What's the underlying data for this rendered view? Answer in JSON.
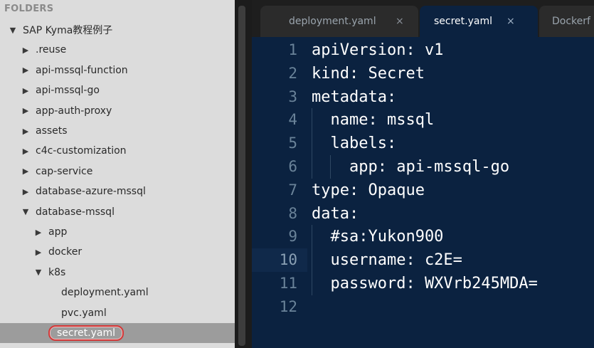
{
  "sidebar": {
    "header": "FOLDERS",
    "items": [
      {
        "label": "SAP Kyma教程例子",
        "state": "expanded",
        "depth": 0
      },
      {
        "label": ".reuse",
        "state": "collapsed",
        "depth": 1
      },
      {
        "label": "api-mssql-function",
        "state": "collapsed",
        "depth": 1
      },
      {
        "label": "api-mssql-go",
        "state": "collapsed",
        "depth": 1
      },
      {
        "label": "app-auth-proxy",
        "state": "collapsed",
        "depth": 1
      },
      {
        "label": "assets",
        "state": "collapsed",
        "depth": 1
      },
      {
        "label": "c4c-customization",
        "state": "collapsed",
        "depth": 1
      },
      {
        "label": "cap-service",
        "state": "collapsed",
        "depth": 1
      },
      {
        "label": "database-azure-mssql",
        "state": "collapsed",
        "depth": 1
      },
      {
        "label": "database-mssql",
        "state": "expanded",
        "depth": 1
      },
      {
        "label": "app",
        "state": "collapsed",
        "depth": 2
      },
      {
        "label": "docker",
        "state": "collapsed",
        "depth": 2
      },
      {
        "label": "k8s",
        "state": "expanded",
        "depth": 2
      },
      {
        "label": "deployment.yaml",
        "state": "file",
        "depth": 3
      },
      {
        "label": "pvc.yaml",
        "state": "file",
        "depth": 3
      },
      {
        "label": "secret.yaml",
        "state": "file-selected",
        "depth": 3
      }
    ]
  },
  "tabs": [
    {
      "label": "deployment.yaml",
      "close": "×",
      "active": false
    },
    {
      "label": "secret.yaml",
      "close": "×",
      "active": true
    },
    {
      "label": "Dockerf",
      "close": "",
      "active": false
    }
  ],
  "editor": {
    "current_line": 10,
    "lines": [
      {
        "num": "1",
        "text": "apiVersion: v1",
        "indent": 0
      },
      {
        "num": "2",
        "text": "kind: Secret",
        "indent": 0
      },
      {
        "num": "3",
        "text": "metadata:",
        "indent": 0
      },
      {
        "num": "4",
        "text": "  name: mssql",
        "indent": 1
      },
      {
        "num": "5",
        "text": "  labels:",
        "indent": 1
      },
      {
        "num": "6",
        "text": "    app: api-mssql-go",
        "indent": 2
      },
      {
        "num": "7",
        "text": "type: Opaque",
        "indent": 0
      },
      {
        "num": "8",
        "text": "data:",
        "indent": 0
      },
      {
        "num": "9",
        "text": "  #sa:Yukon900",
        "indent": 1
      },
      {
        "num": "10",
        "text": "  username: c2E=",
        "indent": 1
      },
      {
        "num": "11",
        "text": "  password: WXVrb245MDA=",
        "indent": 1
      },
      {
        "num": "12",
        "text": "",
        "indent": 0
      }
    ]
  },
  "colors": {
    "editor_bg": "#0b2240",
    "sidebar_bg": "#dcdcdc",
    "selection_outline": "#d23a3a"
  }
}
